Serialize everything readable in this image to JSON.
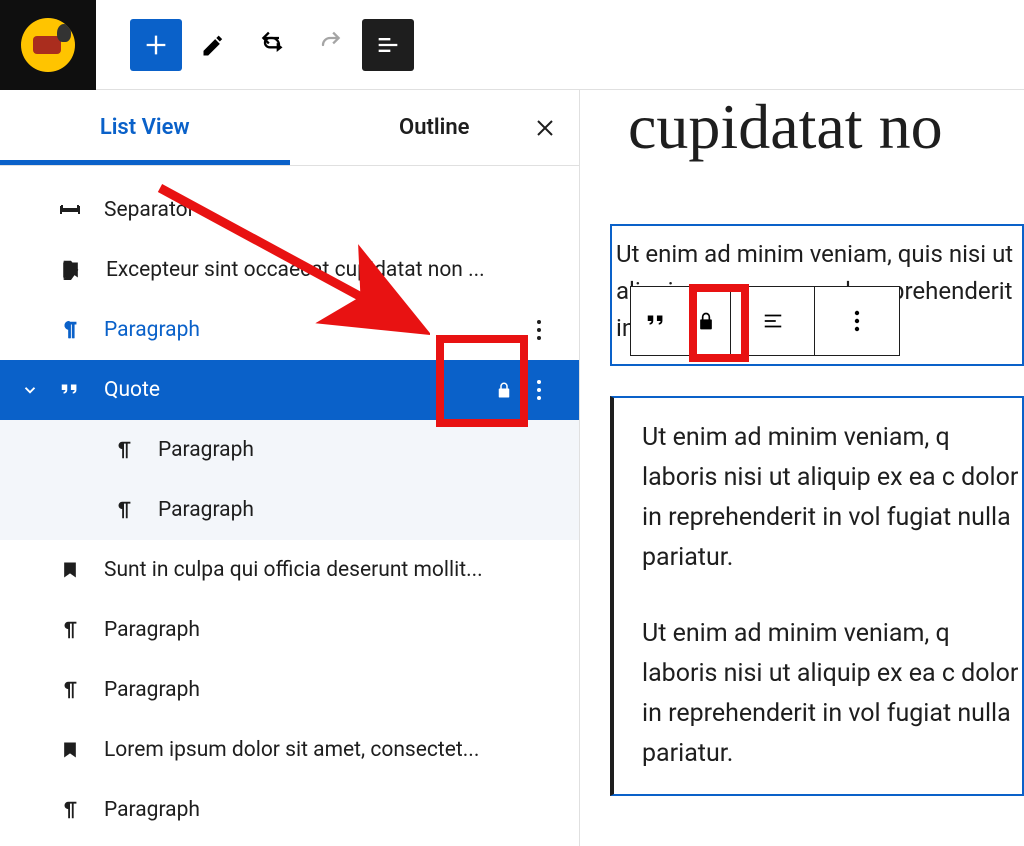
{
  "toolbar": {
    "add": "Add block",
    "tools": "Tools",
    "undo": "Undo",
    "redo": "Redo",
    "outline": "Document Overview"
  },
  "panel": {
    "tabs": {
      "list": "List View",
      "outline": "Outline"
    },
    "close": "Close"
  },
  "list": [
    {
      "icon": "separator",
      "label": "Separator"
    },
    {
      "icon": "heading",
      "label": "Excepteur sint occaecat cupidatat non ..."
    },
    {
      "icon": "paragraph",
      "label": "Paragraph",
      "link": true,
      "options": true
    },
    {
      "icon": "quote",
      "label": "Quote",
      "selected": true,
      "expanded": true,
      "locked": true,
      "options": true
    },
    {
      "icon": "paragraph",
      "label": "Paragraph",
      "child": true
    },
    {
      "icon": "paragraph",
      "label": "Paragraph",
      "child": true
    },
    {
      "icon": "heading",
      "label": "Sunt in culpa qui officia deserunt mollit..."
    },
    {
      "icon": "paragraph",
      "label": "Paragraph"
    },
    {
      "icon": "paragraph",
      "label": "Paragraph"
    },
    {
      "icon": "heading",
      "label": "Lorem ipsum dolor sit amet, consectet..."
    },
    {
      "icon": "paragraph",
      "label": "Paragraph"
    }
  ],
  "content": {
    "heading": "cupidatat no",
    "para": "Ut enim ad minim veniam, quis nisi ut aliquip ex ea commodo reprehenderit in voluptate veli",
    "quote_p1": "Ut enim ad minim veniam, q laboris nisi ut aliquip ex ea c dolor in reprehenderit in vol fugiat nulla pariatur.",
    "quote_p2": "Ut enim ad minim veniam, q laboris nisi ut aliquip ex ea c dolor in reprehenderit in vol fugiat nulla pariatur."
  },
  "block_toolbar": {
    "quote": "Quote",
    "lock": "Locked",
    "align": "Align",
    "options": "Options"
  }
}
